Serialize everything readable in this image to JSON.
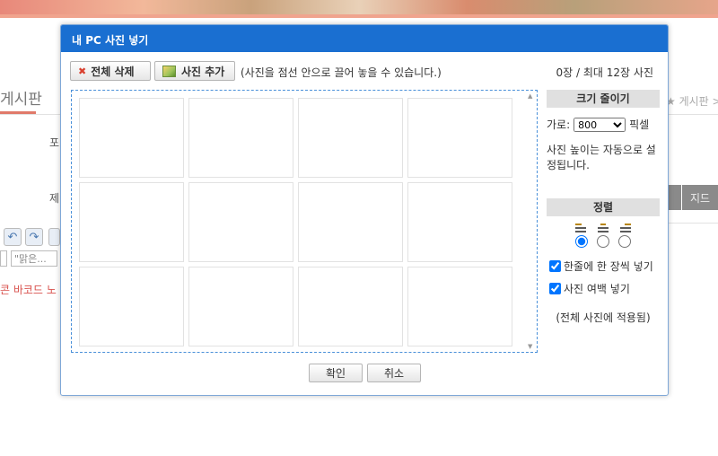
{
  "background": {
    "board_title": "게시판",
    "label_1": "포",
    "label_2": "제",
    "right_board": "★ 게시판 >",
    "gray_btn_2": "지드",
    "select_placeholder": "\"맑은...",
    "red_text": "콘 바코드 노"
  },
  "dialog": {
    "title": "내 PC 사진 넣기",
    "delete_all_label": "전체 삭제",
    "add_photo_label": "사진 추가",
    "drag_hint": "(사진을 점선 안으로 끌어 놓을 수 있습니다.)",
    "photo_count": "0장 / 최대 12장 사진",
    "resize": {
      "heading": "크기 줄이기",
      "width_label": "가로:",
      "width_value": "800",
      "unit": "픽셀",
      "auto_note": "사진 높이는 자동으로 설정됩니다."
    },
    "align": {
      "heading": "정렬",
      "options": [
        "left",
        "center",
        "right"
      ],
      "selected": "left"
    },
    "options": {
      "one_per_line_label": "한줄에 한 장씩 넣기",
      "one_per_line_checked": true,
      "margin_label": "사진 여백 넣기",
      "margin_checked": true,
      "apply_note": "(전체 사진에 적용됨)"
    },
    "confirm_label": "확인",
    "cancel_label": "취소"
  },
  "colors": {
    "header_blue": "#1a6fd1",
    "drop_border": "#4a90d9",
    "delete_icon_red": "#d9402f"
  }
}
